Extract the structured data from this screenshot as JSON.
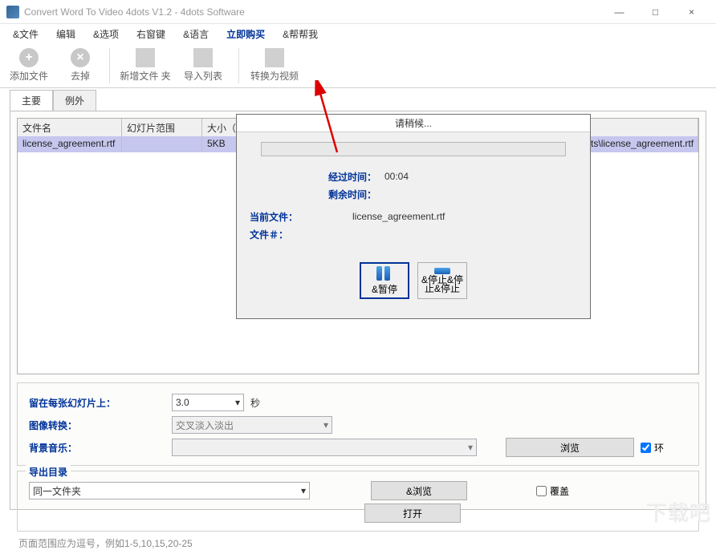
{
  "window": {
    "title": "Convert Word To Video 4dots V1.2 - 4dots Software",
    "min": "—",
    "max": "□",
    "close": "×"
  },
  "menu": {
    "file": "&文件",
    "edit": "编辑",
    "options": "&选项",
    "rightkey": "右窗键",
    "language": "&语言",
    "buy": "立即购买",
    "help": "&帮帮我"
  },
  "toolbar": {
    "add": "添加文件",
    "remove": "去掉",
    "addfolder": "新增文件 夹",
    "importlist": "导入列表",
    "convert": "转换为视频"
  },
  "tabs": {
    "main": "主要",
    "exception": "例外"
  },
  "grid": {
    "col_filename": "文件名",
    "col_sliderange": "幻灯片范围",
    "col_size": "大小（KB）",
    "row_filename": "license_agreement.rtf",
    "row_size": "5KB",
    "row_path": "4dots\\license_agreement.rtf"
  },
  "settings": {
    "stay_label": "留在每张幻灯片上：",
    "stay_value": "3.0",
    "stay_unit": "秒",
    "transition_label": "图像转换：",
    "transition_value": "交叉淡入淡出",
    "music_label": "背景音乐：",
    "browse": "浏览",
    "loop": "环",
    "outdir_label": "导出目录",
    "outdir_value": "同一文件夹",
    "browse2": "&浏览",
    "open": "打开",
    "overwrite": "覆盖"
  },
  "hint": "页面范围应为逗号，例如1-5,10,15,20-25",
  "dialog": {
    "title": "请稍候...",
    "elapsed_label": "经过时间：",
    "elapsed_value": "00:04",
    "remaining_label": "剩余时间：",
    "current_file_label": "当前文件：",
    "current_file_value": "license_agreement.rtf",
    "file_num_label": "文件＃：",
    "pause": "&暂停",
    "stop": "&停止&停止&停止"
  },
  "watermark": "下载吧"
}
